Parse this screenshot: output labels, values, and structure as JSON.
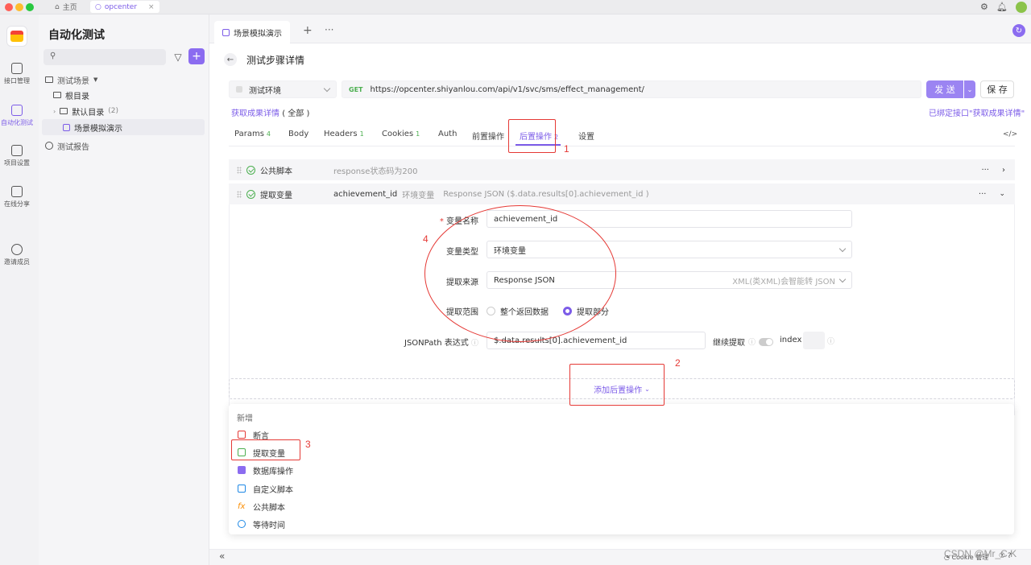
{
  "window": {
    "tabs": [
      {
        "label": "主页"
      },
      {
        "label": "opcenter"
      }
    ]
  },
  "rail": [
    {
      "label": "接口管理"
    },
    {
      "label": "自动化测试"
    },
    {
      "label": "项目设置"
    },
    {
      "label": "在线分享"
    },
    {
      "label": "邀请成员"
    }
  ],
  "tree": {
    "title": "自动化测试",
    "items": [
      {
        "label": "测试场景"
      },
      {
        "label": "根目录"
      },
      {
        "label": "默认目录",
        "count": "(2)"
      },
      {
        "label": "场景模拟演示"
      },
      {
        "label": "测试报告"
      }
    ]
  },
  "main": {
    "doc_tab": "场景模拟演示",
    "page_title": "测试步骤详情",
    "env": "测试环境",
    "method": "GET",
    "url": "https://opcenter.shiyanlou.com/api/v1/svc/sms/effect_management/",
    "send": "发 送",
    "save": "保 存",
    "api_name": "获取成果详情",
    "api_scope": "( 全部 )",
    "bound": "已绑定接口\"获取成果详情\"",
    "tabs": [
      {
        "label": "Params",
        "count": "4"
      },
      {
        "label": "Body",
        "count": ""
      },
      {
        "label": "Headers",
        "count": "1"
      },
      {
        "label": "Cookies",
        "count": "1"
      },
      {
        "label": "Auth",
        "count": ""
      },
      {
        "label": "前置操作",
        "count": ""
      },
      {
        "label": "后置操作",
        "count": "2"
      },
      {
        "label": "设置",
        "count": ""
      }
    ],
    "row1": {
      "name": "公共脚本",
      "desc": "response状态码为200"
    },
    "row2": {
      "name": "提取变量",
      "var": "achievement_id",
      "type": "环境变量",
      "desc": "Response JSON ($.data.results[0].achievement_id )"
    },
    "form": {
      "var_name_label": "变量名称",
      "var_name": "achievement_id",
      "var_type_label": "变量类型",
      "var_type": "环境变量",
      "source_label": "提取来源",
      "source": "Response JSON",
      "source_hint": "XML(类XML)会智能转 JSON",
      "range_label": "提取范围",
      "range_opt1": "整个返回数据",
      "range_opt2": "提取部分",
      "jsonpath_label": "JSONPath 表达式",
      "jsonpath": "$.data.results[0].achievement_id",
      "continue_label": "继续提取",
      "index_label": "index"
    },
    "add_post": "添加后置操作",
    "menu": {
      "header": "新增",
      "items": [
        {
          "label": "断言",
          "color": "#e53935"
        },
        {
          "label": "提取变量",
          "color": "#4caf50"
        },
        {
          "label": "数据库操作",
          "color": "#7c5ce8"
        },
        {
          "label": "自定义脚本",
          "color": "#1e88e5"
        },
        {
          "label": "公共脚本",
          "color": "#fb8c00"
        },
        {
          "label": "等待时间",
          "color": "#1e88e5"
        }
      ]
    },
    "footer": "Cookie 管理"
  },
  "annotations": [
    "1",
    "2",
    "3",
    "4"
  ],
  "watermark": "CSDN @Mr_C.K",
  "accent": "#7c5ce8"
}
